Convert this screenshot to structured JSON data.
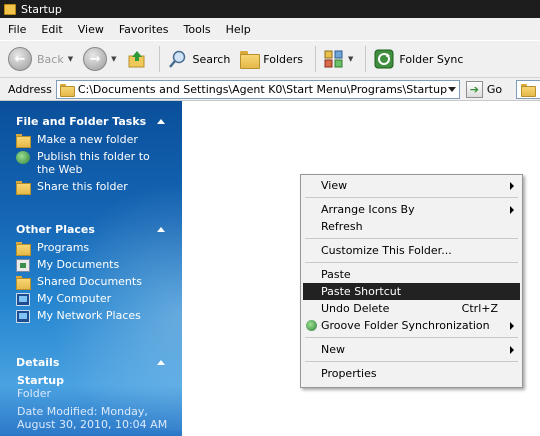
{
  "window": {
    "title": "Startup"
  },
  "menubar": [
    "File",
    "Edit",
    "View",
    "Favorites",
    "Tools",
    "Help"
  ],
  "toolbar": {
    "back": "Back",
    "search": "Search",
    "folders": "Folders",
    "folder_sync": "Folder Sync"
  },
  "address": {
    "label": "Address",
    "path": "C:\\Documents and Settings\\Agent K0\\Start Menu\\Programs\\Startup",
    "go": "Go"
  },
  "taskpane": {
    "file_folder_tasks": {
      "title": "File and Folder Tasks",
      "items": [
        "Make a new folder",
        "Publish this folder to the Web",
        "Share this folder"
      ]
    },
    "other_places": {
      "title": "Other Places",
      "items": [
        "Programs",
        "My Documents",
        "Shared Documents",
        "My Computer",
        "My Network Places"
      ]
    },
    "details": {
      "title": "Details",
      "name": "Startup",
      "type": "Folder",
      "modified": "Date Modified: Monday, August 30, 2010, 10:04 AM"
    }
  },
  "context_menu": {
    "items": [
      {
        "label": "View",
        "submenu": true
      },
      {
        "separator": true
      },
      {
        "label": "Arrange Icons By",
        "submenu": true
      },
      {
        "label": "Refresh"
      },
      {
        "separator": true
      },
      {
        "label": "Customize This Folder..."
      },
      {
        "separator": true
      },
      {
        "label": "Paste"
      },
      {
        "label": "Paste Shortcut",
        "highlighted": true
      },
      {
        "label": "Undo Delete",
        "accelerator": "Ctrl+Z"
      },
      {
        "label": "Groove Folder Synchronization",
        "submenu": true,
        "icon": "groove-icon"
      },
      {
        "separator": true
      },
      {
        "label": "New",
        "submenu": true
      },
      {
        "separator": true
      },
      {
        "label": "Properties"
      }
    ]
  }
}
